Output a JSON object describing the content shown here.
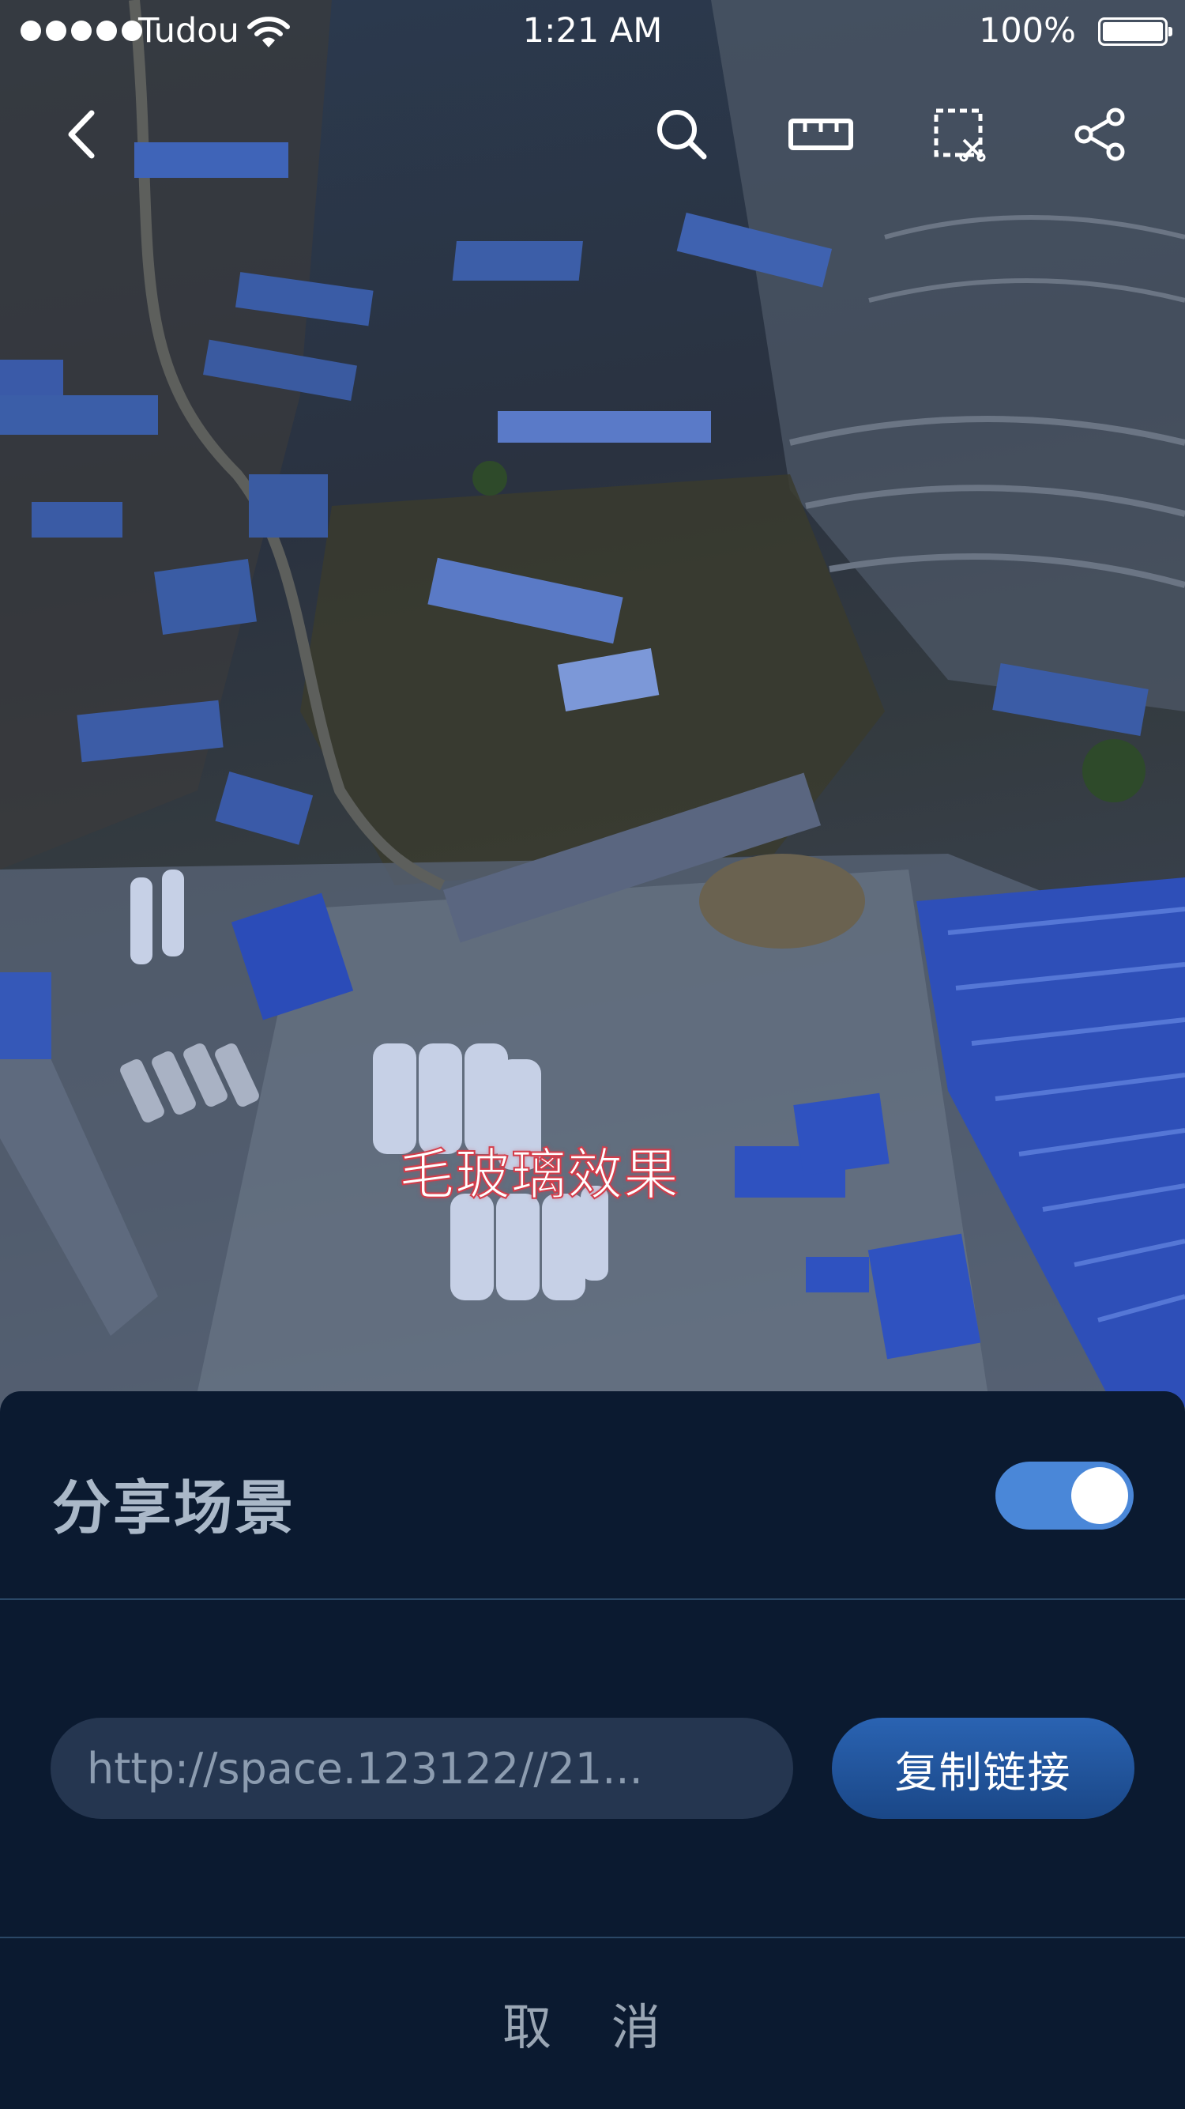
{
  "status_bar": {
    "carrier": "Tudou",
    "time": "1:21 AM",
    "battery": "100%",
    "battery_level": 1.0
  },
  "toolbar": {
    "icons": [
      "back-icon",
      "search-icon",
      "ruler-icon",
      "screenshot-icon",
      "share-icon"
    ]
  },
  "scene": {
    "overlay_label": "毛玻璃效果"
  },
  "share_sheet": {
    "title": "分享场景",
    "toggle_on": true,
    "url_value": "http://space.123122//21...",
    "copy_button": "复制链接",
    "cancel_button": "取 消"
  },
  "colors": {
    "sheet_background": "#0b1a30",
    "accent": "#4a87d8",
    "copy_button": "#1f55a0",
    "overlay_label_stroke": "#d43c4a"
  }
}
